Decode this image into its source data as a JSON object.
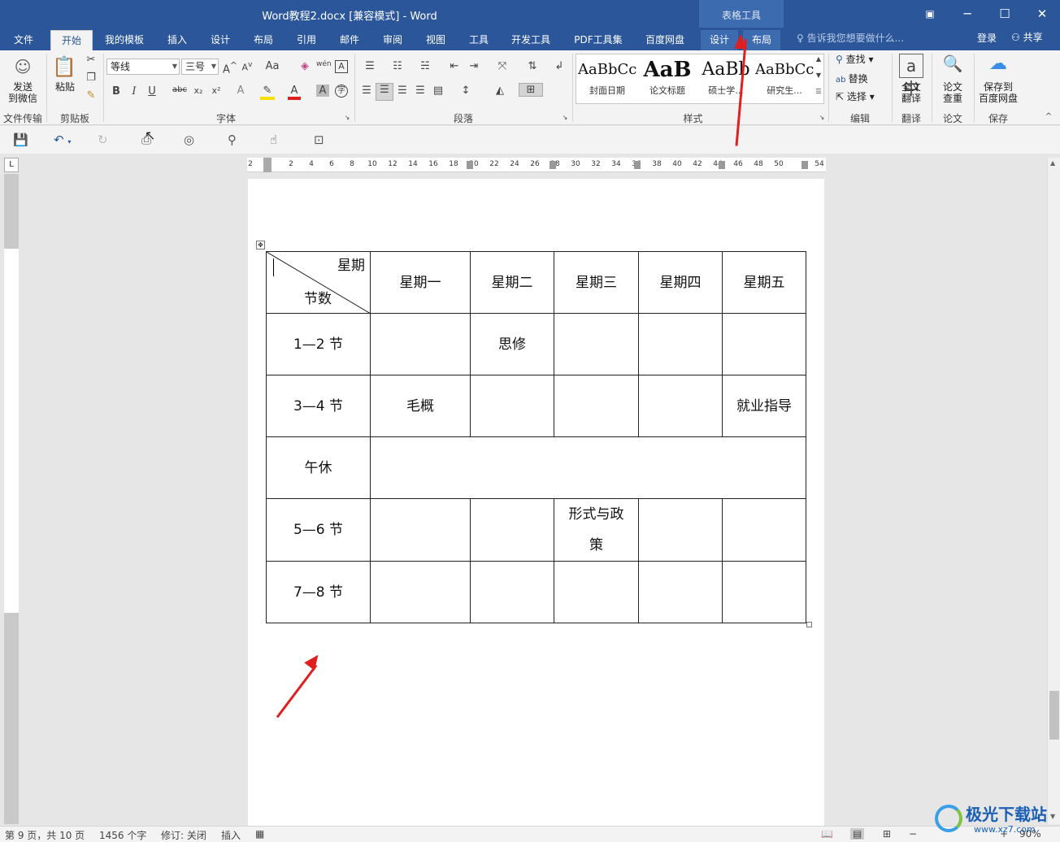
{
  "titlebar": {
    "title": "Word教程2.docx [兼容模式] - Word",
    "context_label": "表格工具",
    "restore_icon": "ribbon-display-icon",
    "min_label": "─",
    "max_label": "☐",
    "close_label": "✕"
  },
  "tabs": [
    {
      "label": "文件"
    },
    {
      "label": "开始"
    },
    {
      "label": "我的模板"
    },
    {
      "label": "插入"
    },
    {
      "label": "设计"
    },
    {
      "label": "布局"
    },
    {
      "label": "引用"
    },
    {
      "label": "邮件"
    },
    {
      "label": "审阅"
    },
    {
      "label": "视图"
    },
    {
      "label": "工具"
    },
    {
      "label": "开发工具"
    },
    {
      "label": "PDF工具集"
    },
    {
      "label": "百度网盘"
    },
    {
      "label": "设计"
    },
    {
      "label": "布局"
    }
  ],
  "tellme": "告诉我您想要做什么...",
  "login": "登录",
  "share": "共享",
  "ribbon": {
    "send_wechat": "发送\n到微信",
    "send_wechat_l1": "发送",
    "send_wechat_l2": "到微信",
    "paste": "粘贴",
    "font_name": "等线",
    "font_size": "三号",
    "groups": {
      "file_transfer": "文件传输",
      "clipboard": "剪贴板",
      "font": "字体",
      "paragraph": "段落",
      "styles": "样式",
      "edit": "编辑",
      "translate": "翻译",
      "paper": "论文",
      "save": "保存"
    },
    "styles": [
      {
        "sample": "AaBbCc",
        "name": "封面日期"
      },
      {
        "sample": "AaB",
        "name": "论文标题"
      },
      {
        "sample": "AaBb",
        "name": "硕士学..."
      },
      {
        "sample": "AaBbCc",
        "name": "研究生..."
      }
    ],
    "find": "查找",
    "replace": "替换",
    "select": "选择",
    "full_translate_l1": "全文",
    "full_translate_l2": "翻译",
    "paper_check_l1": "论文",
    "paper_check_l2": "查重",
    "save_baidu_l1": "保存到",
    "save_baidu_l2": "百度网盘"
  },
  "ruler_numbers": [
    "2",
    "2",
    "4",
    "6",
    "8",
    "10",
    "12",
    "14",
    "16",
    "18",
    "20",
    "22",
    "24",
    "26",
    "28",
    "30",
    "32",
    "34",
    "36",
    "38",
    "40",
    "42",
    "44",
    "46",
    "48",
    "50",
    "54"
  ],
  "table": {
    "diag_top": "星期",
    "diag_bottom": "节数",
    "headers": [
      "星期一",
      "星期二",
      "星期三",
      "星期四",
      "星期五"
    ],
    "rows": [
      {
        "label": "1—2 节",
        "cells": [
          "",
          "思修",
          "",
          "",
          ""
        ]
      },
      {
        "label": "3—4 节",
        "cells": [
          "毛概",
          "",
          "",
          "",
          "就业指导"
        ]
      },
      {
        "label": "午休",
        "merged": ""
      },
      {
        "label": "5—6 节",
        "cells": [
          "",
          "",
          "形式与政策",
          "",
          ""
        ]
      },
      {
        "label": "7—8 节",
        "cells": [
          "",
          "",
          "",
          "",
          ""
        ]
      }
    ]
  },
  "status": {
    "page": "第 9 页，共 10 页",
    "words": "1456 个字",
    "track": "修订: 关闭",
    "insert": "插入",
    "zoom": "90%"
  },
  "watermark": {
    "title": "极光下载站",
    "subtitle": "www.xz7.com"
  },
  "colors": {
    "word_blue": "#2b579a",
    "context_tab": "#3c6bb0",
    "annotation_red": "#e02020"
  }
}
